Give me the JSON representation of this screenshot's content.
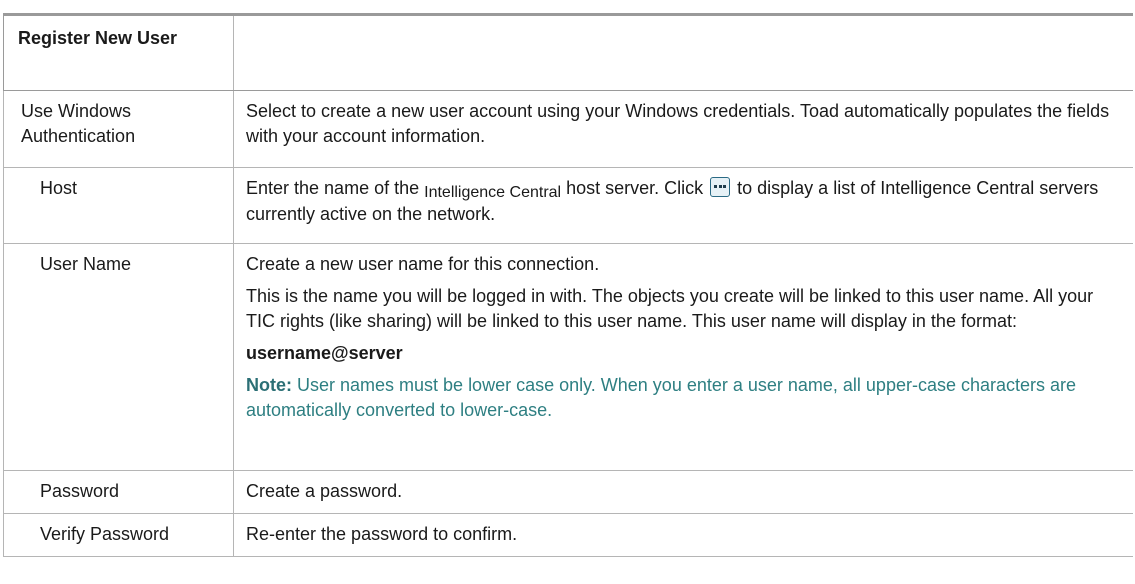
{
  "table": {
    "header": {
      "title": "Register New User",
      "second": ""
    },
    "rows": [
      {
        "term": "Use Windows Authentication",
        "desc": "Select to create a new user account using your Windows credentials. Toad automatically populates the fields with your account information."
      },
      {
        "term": "Host",
        "desc_part1": "Enter the name of the ",
        "desc_highlight": "Intelligence Central",
        "desc_part2": " host server. Click ",
        "desc_part3": " to display a list of Intelligence Central servers currently active on the network.",
        "icon": "ellipsis-icon"
      },
      {
        "term": "User Name",
        "desc_p1": "Create a new user name for this connection.",
        "desc_p2": "This is the name you will be logged in with. The objects you create will be linked to this user name. All your TIC rights (like sharing) will be linked to this user name. This user name will display in the format:",
        "desc_format": "username@server",
        "note_label": "Note:",
        "note_text": " User names must be lower case only. When you enter a user name, all upper-case characters are automatically converted to lower-case."
      },
      {
        "term": "Password",
        "desc": "Create a password."
      },
      {
        "term": "Verify Password",
        "desc": "Re-enter the password to confirm."
      }
    ]
  },
  "colors": {
    "border": "#b5b5b5",
    "note": "#2e7f82",
    "icon_border": "#2b6a84"
  }
}
